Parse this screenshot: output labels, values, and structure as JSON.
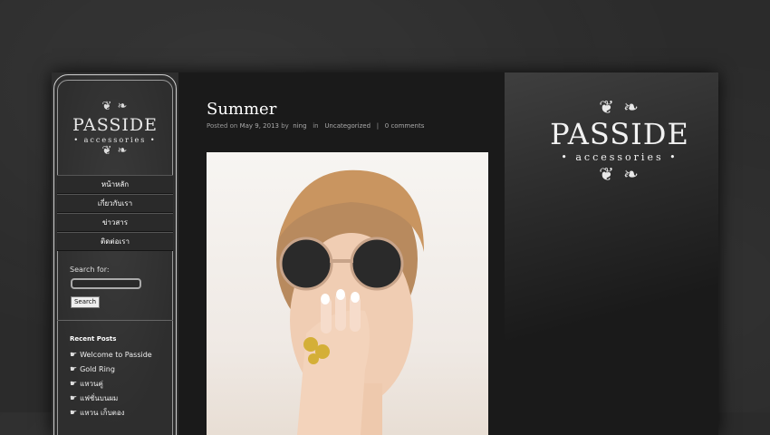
{
  "logo": {
    "flourish": "❦ ❧",
    "brand": "PASSIDE",
    "subtitle": "• accessories •"
  },
  "nav": {
    "items": [
      "หน้าหลัก",
      "เกี่ยวกับเรา",
      "ข่าวสาร",
      "ติดต่อเรา"
    ]
  },
  "search": {
    "label": "Search for:",
    "value": "",
    "button": "Search"
  },
  "recent": {
    "title": "Recent Posts",
    "items": [
      "Welcome to Passide",
      "Gold Ring",
      "แหวนคู่",
      "แฟชั่นบนผม",
      "แหวน เก็บตอง"
    ],
    "icon": "pointing-hand-icon"
  },
  "post": {
    "title": "Summer",
    "posted_prefix": "Posted on",
    "date": "May 9, 2013",
    "by": "by",
    "author": "ning",
    "in": "in",
    "category": "Uncategorized",
    "separator": "|",
    "comments": "0 comments"
  },
  "colors": {
    "frame_bg": "#1a1a1a",
    "sidebar_bg": "#2e2e2e",
    "text": "#ffffff"
  }
}
